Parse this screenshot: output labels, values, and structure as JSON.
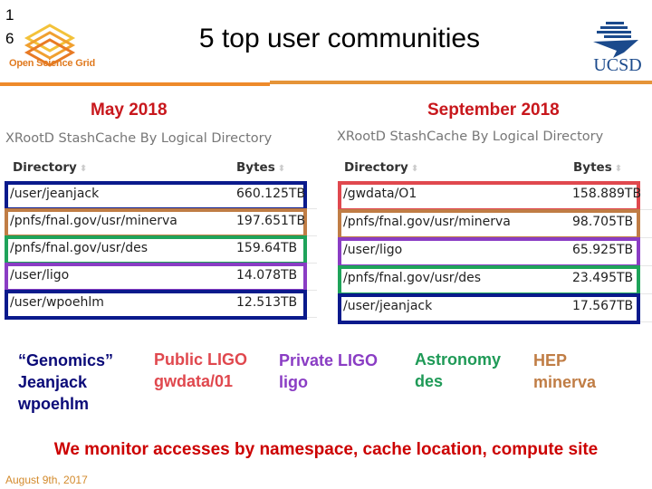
{
  "slide_number": "16",
  "logos": {
    "osg": "Open Science Grid",
    "ucsd": "UCSD"
  },
  "title": "5 top user communities",
  "panels": [
    {
      "period": "May 2018",
      "panel_title": "XRootD StashCache By Logical Directory",
      "columns": [
        "Directory",
        "Bytes"
      ],
      "rows": [
        {
          "directory": "/user/jeanjack",
          "bytes": "660.125TB",
          "color": "#0a1a8c"
        },
        {
          "directory": "/pnfs/fnal.gov/usr/minerva",
          "bytes": "197.651TB",
          "color": "#c07d45"
        },
        {
          "directory": "/pnfs/fnal.gov/usr/des",
          "bytes": "159.64TB",
          "color": "#1fa35a"
        },
        {
          "directory": "/user/ligo",
          "bytes": "14.078TB",
          "color": "#8a3dc4"
        },
        {
          "directory": "/user/wpoehlm",
          "bytes": "12.513TB",
          "color": "#0a1a8c"
        }
      ]
    },
    {
      "period": "September 2018",
      "panel_title": "XRootD StashCache By Logical Directory",
      "columns": [
        "Directory",
        "Bytes"
      ],
      "rows": [
        {
          "directory": "/gwdata/O1",
          "bytes": "158.889TB",
          "color": "#e0484e"
        },
        {
          "directory": "/pnfs/fnal.gov/usr/minerva",
          "bytes": "98.705TB",
          "color": "#c07d45"
        },
        {
          "directory": "/user/ligo",
          "bytes": "65.925TB",
          "color": "#8a3dc4"
        },
        {
          "directory": "/pnfs/fnal.gov/usr/des",
          "bytes": "23.495TB",
          "color": "#1fa35a"
        },
        {
          "directory": "/user/jeanjack",
          "bytes": "17.567TB",
          "color": "#0a1a8c"
        }
      ]
    }
  ],
  "communities": [
    {
      "lines": [
        "“Genomics”",
        "Jeanjack",
        "wpoehlm"
      ],
      "color": "#0a0a78"
    },
    {
      "lines": [
        "Public LIGO",
        "gwdata/01"
      ],
      "color": "#e0484e"
    },
    {
      "lines": [
        "Private LIGO",
        "ligo"
      ],
      "color": "#8a3dc4"
    },
    {
      "lines": [
        "Astronomy",
        "des"
      ],
      "color": "#1f9a57"
    },
    {
      "lines": [
        "HEP",
        "minerva"
      ],
      "color": "#c07d45"
    }
  ],
  "footer_message": "We monitor accesses by namespace, cache location, compute site",
  "date": "August 9th, 2017",
  "colors": {
    "accent_orange": "#ee8a2a",
    "heading_red": "#c8171c"
  }
}
